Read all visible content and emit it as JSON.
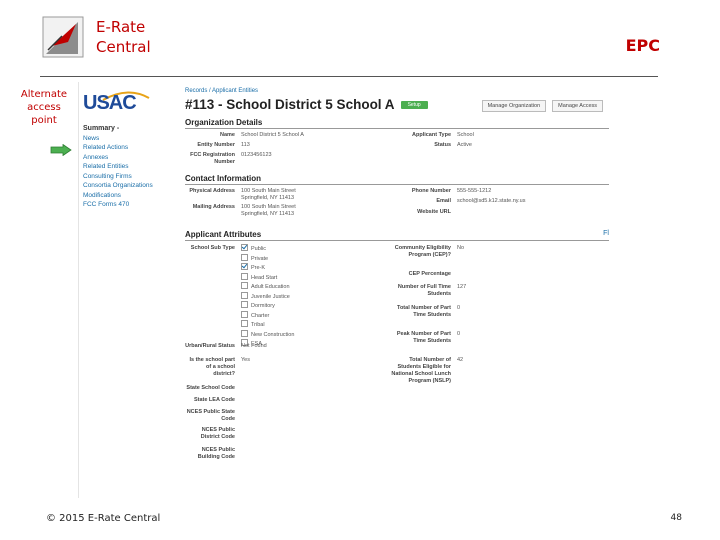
{
  "header": {
    "brand_line1": "E-Rate",
    "brand_line2": "Central",
    "right_label": "EPC"
  },
  "note": {
    "line1": "Alternate",
    "line2": "access",
    "line3": "point"
  },
  "screenshot": {
    "logo_text": "USAC",
    "sidebar": {
      "heading": "Summary -",
      "items": [
        "News",
        "Related Actions",
        "Annexes",
        "Related Entities",
        "Consulting Firms",
        "Consortia Organizations",
        "Modifications",
        "FCC Forms 470"
      ]
    },
    "breadcrumb": "Records / Applicant Entities",
    "title": "#113 - School District 5 School A",
    "badge": "Setup",
    "buttons": {
      "manage_org": "Manage Organization",
      "manage_access": "Manage Access"
    },
    "org_details": {
      "heading": "Organization Details",
      "name_label": "Name",
      "name_value": "School District 5 School A",
      "entity_label": "Entity Number",
      "entity_value": "113",
      "fcc_label": "FCC Registration Number",
      "fcc_value": "0123456123",
      "type_label": "Applicant Type",
      "type_value": "School",
      "status_label": "Status",
      "status_value": "Active"
    },
    "contact": {
      "heading": "Contact Information",
      "phys_label": "Physical Address",
      "phys_line1": "100 South Main Street",
      "phys_line2": "Springfield, NY 11413",
      "mail_label": "Mailing Address",
      "mail_line1": "100 South Main Street",
      "mail_line2": "Springfield, NY 11413",
      "phone_label": "Phone Number",
      "phone_value": "555-555-1212",
      "email_label": "Email",
      "email_value": "school@sd5.k12.state.ny.us",
      "website_label": "Website URL",
      "website_value": ""
    },
    "attributes": {
      "heading": "Applicant Attributes",
      "edit_link": "Fl",
      "subtype_label": "School Sub Type",
      "subtypes": [
        {
          "label": "Public",
          "checked": true
        },
        {
          "label": "Private",
          "checked": false
        },
        {
          "label": "Pre-K",
          "checked": true
        },
        {
          "label": "Head Start",
          "checked": false
        },
        {
          "label": "Adult Education",
          "checked": false
        },
        {
          "label": "Juvenile Justice",
          "checked": false
        },
        {
          "label": "Dormitory",
          "checked": false
        },
        {
          "label": "Charter",
          "checked": false
        },
        {
          "label": "Tribal",
          "checked": false
        },
        {
          "label": "New Construction",
          "checked": false
        },
        {
          "label": "ESA",
          "checked": false
        }
      ],
      "urban_label": "Urban/Rural Status",
      "urban_value": "Not Found",
      "part_label": "Is the school part of a school district?",
      "part_value": "Yes",
      "state_code_label": "State School Code",
      "state_lea_label": "State LEA Code",
      "nces_school_label": "NCES Public State Code",
      "nces_district_label": "NCES Public District Code",
      "nces_building_label": "NCES Public Building Code",
      "cep_label": "Community Eligibility Program (CEP)?",
      "cep_value": "No",
      "cep_pct_label": "CEP Percentage",
      "cep_pct_value": "",
      "fulltime_label": "Number of Full Time Students",
      "fulltime_value": "127",
      "parttime_label": "Total Number of Part Time Students",
      "parttime_value": "0",
      "peak_label": "Peak Number of Part Time Students",
      "peak_value": "0",
      "nslp_label": "Total Number of Students Eligible for National School Lunch Program (NSLP)",
      "nslp_value": "42"
    }
  },
  "footer": {
    "copyright": "© 2015 E-Rate Central",
    "page": "48"
  },
  "colors": {
    "brand": "#c00000",
    "link": "#1a6ea8",
    "badge": "#4caf50",
    "arrow": "#4caf50"
  }
}
